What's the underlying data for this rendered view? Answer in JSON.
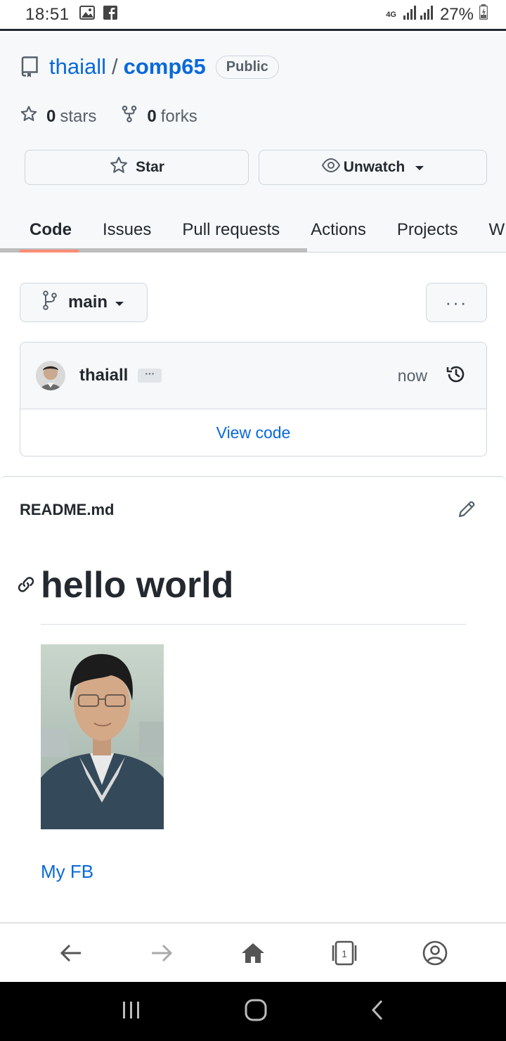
{
  "status_bar": {
    "time": "18:51",
    "network": "4G",
    "battery": "27%"
  },
  "repo": {
    "owner": "thaiall",
    "separator": "/",
    "name": "comp65",
    "visibility": "Public",
    "stars_count": "0",
    "stars_label": "stars",
    "forks_count": "0",
    "forks_label": "forks"
  },
  "buttons": {
    "star_label": "Star",
    "watch_label": "Unwatch"
  },
  "tabs": [
    {
      "label": "Code",
      "active": true
    },
    {
      "label": "Issues"
    },
    {
      "label": "Pull requests"
    },
    {
      "label": "Actions"
    },
    {
      "label": "Projects"
    },
    {
      "label": "W"
    }
  ],
  "branch": {
    "name": "main",
    "more_label": "···"
  },
  "commit": {
    "author": "thaiall",
    "message_toggle": "···",
    "time": "now",
    "view_code_label": "View code"
  },
  "readme": {
    "filename": "README.md",
    "heading": "hello world",
    "link_text": "My FB"
  },
  "colors": {
    "link": "#0969da",
    "tab_underline": "#fd8c73",
    "text": "#24292f",
    "muted": "#57606a"
  },
  "icons": [
    "picture-icon",
    "facebook-icon",
    "signal-icon",
    "battery-icon",
    "repo-icon",
    "star-icon",
    "fork-icon",
    "eye-icon",
    "caret-down-icon",
    "branch-icon",
    "history-icon",
    "pencil-icon",
    "link-icon",
    "back-icon",
    "forward-icon",
    "home-icon",
    "tabs-icon",
    "account-icon",
    "recents-icon",
    "home-circle-icon",
    "nav-back-icon"
  ]
}
